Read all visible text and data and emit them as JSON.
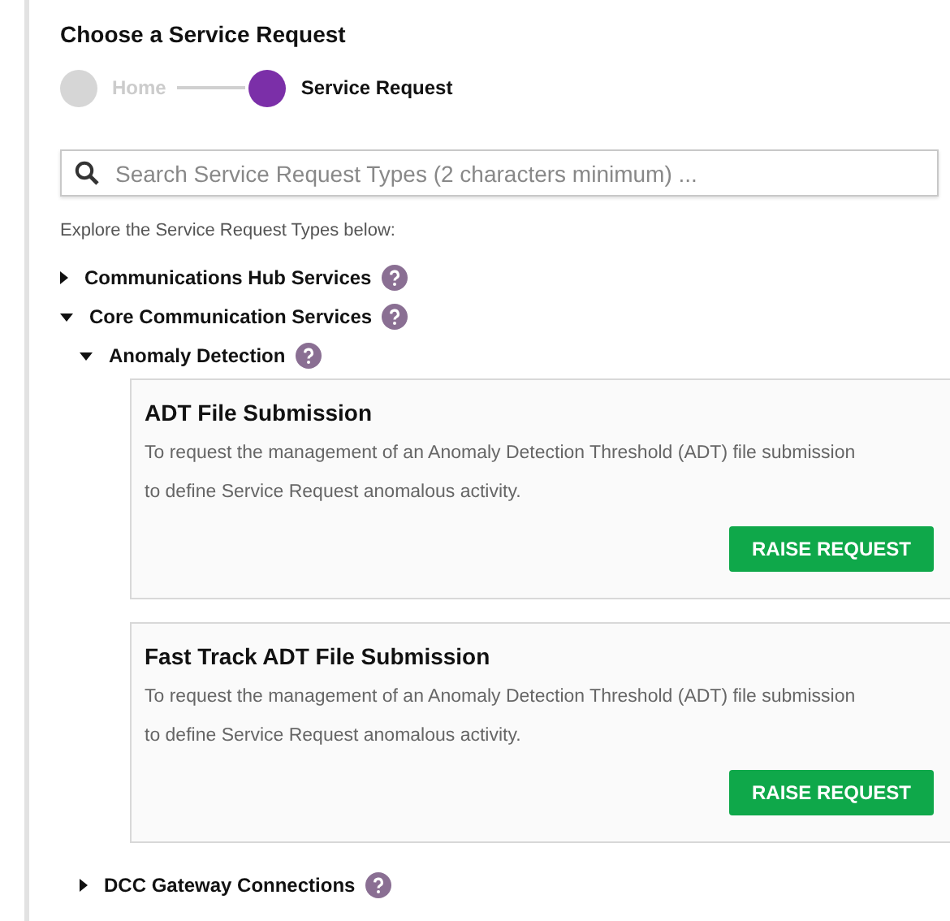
{
  "title": "Choose a Service Request",
  "steps": [
    {
      "label": "Home",
      "selected": false
    },
    {
      "label": "Service Request",
      "selected": true
    }
  ],
  "search": {
    "placeholder": "Search Service Request Types (2 characters minimum) ..."
  },
  "intro": "Explore the Service Request Types below:",
  "tree": [
    {
      "label": "Communications Hub Services",
      "expanded": false
    },
    {
      "label": "Core Communication Services",
      "expanded": true,
      "children": [
        {
          "label": "Anomaly Detection",
          "expanded": true,
          "requests": [
            {
              "title": "ADT File Submission",
              "description": "To request the management of an Anomaly Detection Threshold (ADT) file submission to define Service Request anomalous activity.",
              "button": "RAISE REQUEST"
            },
            {
              "title": "Fast Track ADT File Submission",
              "description": "To request the management of an Anomaly Detection Threshold (ADT) file submission to define Service Request anomalous activity.",
              "button": "RAISE REQUEST"
            }
          ]
        },
        {
          "label": "DCC Gateway Connections",
          "expanded": false
        }
      ]
    }
  ]
}
